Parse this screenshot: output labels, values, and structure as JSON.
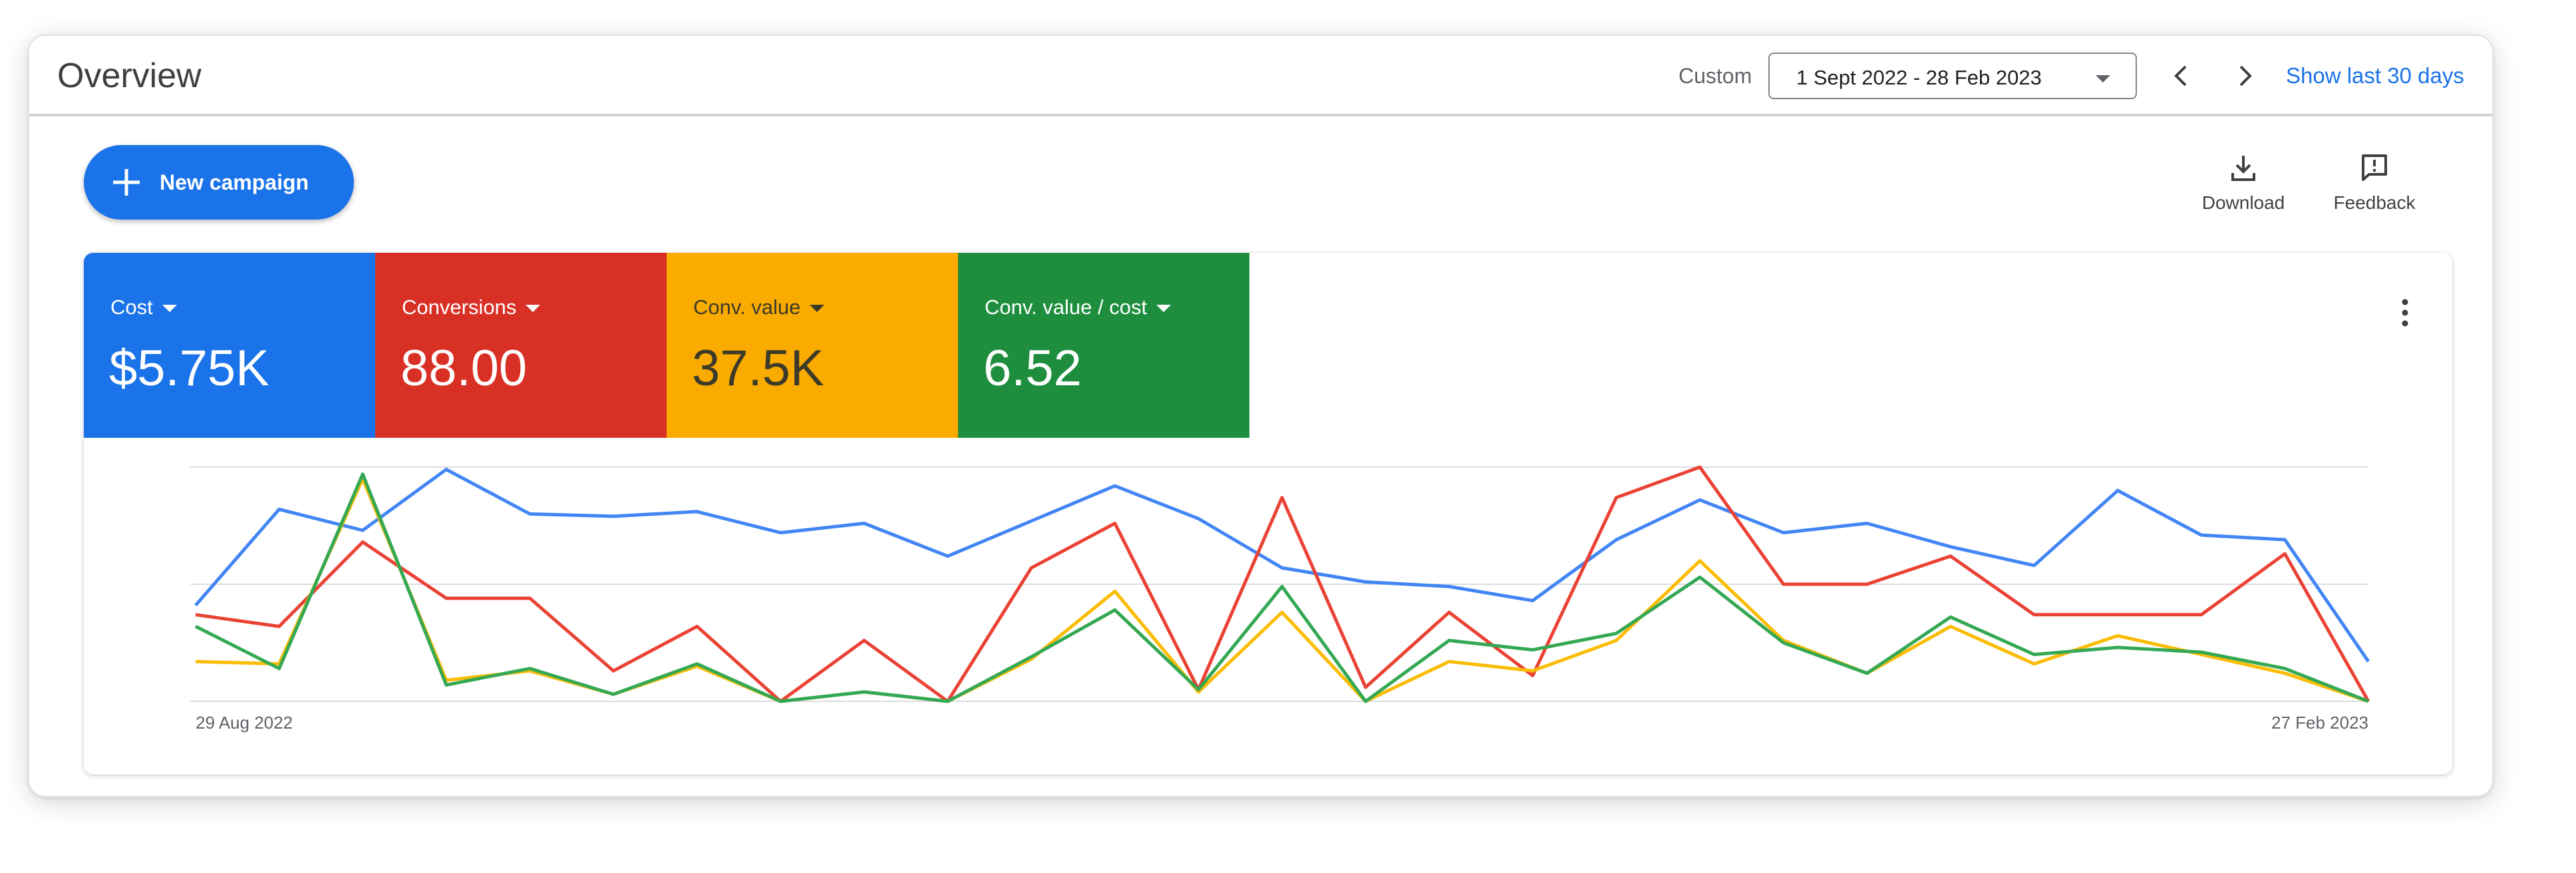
{
  "header": {
    "title": "Overview",
    "custom_label": "Custom",
    "date_range": "1 Sept 2022 - 28 Feb 2023",
    "show_last": "Show last 30 days"
  },
  "actions": {
    "new_campaign": "New campaign",
    "download": "Download",
    "feedback": "Feedback"
  },
  "metrics": [
    {
      "name": "Cost",
      "value": "$5.75K",
      "color": "#1a73e8"
    },
    {
      "name": "Conversions",
      "value": "88.00",
      "color": "#d93025"
    },
    {
      "name": "Conv. value",
      "value": "37.5K",
      "color": "#f9ab00"
    },
    {
      "name": "Conv. value / cost",
      "value": "6.52",
      "color": "#1e8e3e"
    }
  ],
  "chart_data": {
    "type": "line",
    "x_start_label": "29 Aug 2022",
    "x_end_label": "27 Feb 2023",
    "grid": true,
    "ylim": [
      0,
      100
    ],
    "series": [
      {
        "name": "Cost",
        "color": "#4285f4",
        "values": [
          41,
          82,
          73,
          99,
          80,
          79,
          81,
          72,
          76,
          62,
          77,
          92,
          78,
          57,
          51,
          49,
          43,
          69,
          86,
          72,
          76,
          66,
          58,
          90,
          71,
          69,
          17
        ]
      },
      {
        "name": "Conversions",
        "color": "#ea4335",
        "values": [
          37,
          32,
          68,
          44,
          44,
          13,
          32,
          0,
          26,
          0,
          57,
          76,
          5,
          87,
          6,
          38,
          11,
          87,
          100,
          50,
          50,
          62,
          37,
          37,
          37,
          63,
          0
        ]
      },
      {
        "name": "Conv. value",
        "color": "#fbbc04",
        "values": [
          17,
          16,
          95,
          9,
          13,
          3,
          15,
          0,
          4,
          0,
          18,
          47,
          4,
          38,
          0,
          17,
          13,
          26,
          60,
          26,
          12,
          32,
          16,
          28,
          20,
          12,
          0
        ]
      },
      {
        "name": "Conv. value / cost",
        "color": "#34a853",
        "values": [
          32,
          14,
          97,
          7,
          14,
          3,
          16,
          0,
          4,
          0,
          19,
          39,
          5,
          49,
          0,
          26,
          22,
          29,
          53,
          25,
          12,
          36,
          20,
          23,
          21,
          14,
          0
        ]
      }
    ]
  }
}
